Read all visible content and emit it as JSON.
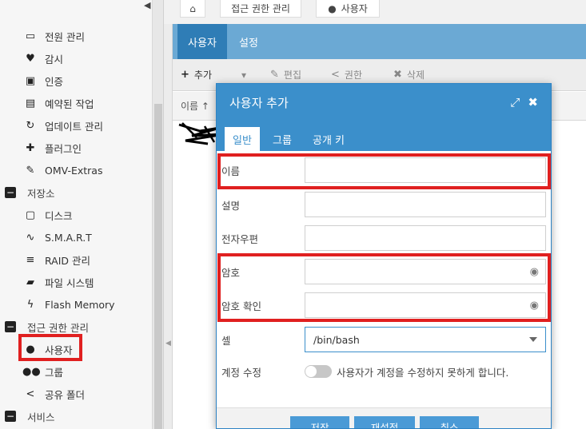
{
  "topbar": {
    "home_icon": "home-icon",
    "crumb_access": "접근 권한 관리",
    "crumb_user": "사용자",
    "user_icon": "user-icon"
  },
  "sidebar": {
    "items": [
      {
        "label": "전원 관리",
        "icon": "battery-icon",
        "type": "child"
      },
      {
        "label": "감시",
        "icon": "heartbeat-icon",
        "type": "child"
      },
      {
        "label": "인증",
        "icon": "certificate-icon",
        "type": "child"
      },
      {
        "label": "예약된 작업",
        "icon": "calendar-icon",
        "type": "child"
      },
      {
        "label": "업데이트 관리",
        "icon": "refresh-icon",
        "type": "child"
      },
      {
        "label": "플러그인",
        "icon": "puzzle-icon",
        "type": "child"
      },
      {
        "label": "OMV-Extras",
        "icon": "wrench-icon",
        "type": "child"
      },
      {
        "label": "저장소",
        "icon": "minus-square-icon",
        "type": "group"
      },
      {
        "label": "디스크",
        "icon": "disk-icon",
        "type": "child"
      },
      {
        "label": "S.M.A.R.T",
        "icon": "pulse-icon",
        "type": "child"
      },
      {
        "label": "RAID 관리",
        "icon": "database-icon",
        "type": "child"
      },
      {
        "label": "파일 시스템",
        "icon": "folder-icon",
        "type": "child"
      },
      {
        "label": "Flash Memory",
        "icon": "flash-icon",
        "type": "child"
      },
      {
        "label": "접근 권한 관리",
        "icon": "minus-square-icon",
        "type": "group"
      },
      {
        "label": "사용자",
        "icon": "user-icon",
        "type": "child"
      },
      {
        "label": "그룹",
        "icon": "users-icon",
        "type": "child"
      },
      {
        "label": "공유 폴더",
        "icon": "share-icon",
        "type": "child"
      },
      {
        "label": "서비스",
        "icon": "minus-square-icon",
        "type": "group"
      }
    ]
  },
  "main": {
    "tabs": [
      "사용자",
      "설정"
    ],
    "toolbar": {
      "add": "추가",
      "edit": "편집",
      "permission": "권한",
      "delete": "삭제"
    },
    "column_name": "이름 ↑"
  },
  "modal": {
    "title": "사용자 추가",
    "tabs": [
      "일반",
      "그룹",
      "공개 키"
    ],
    "fields": {
      "name_label": "이름",
      "desc_label": "설명",
      "email_label": "전자우편",
      "password_label": "암호",
      "password_confirm_label": "암호 확인",
      "shell_label": "셸",
      "shell_value": "/bin/bash",
      "account_edit_label": "계정 수정",
      "account_edit_text": "사용자가 계정을 수정하지 못하게 합니다."
    },
    "buttons": {
      "save": "저장",
      "reset": "재설정",
      "cancel": "취소"
    }
  },
  "colors": {
    "accent": "#3b8fcb",
    "highlight": "#e02020"
  }
}
